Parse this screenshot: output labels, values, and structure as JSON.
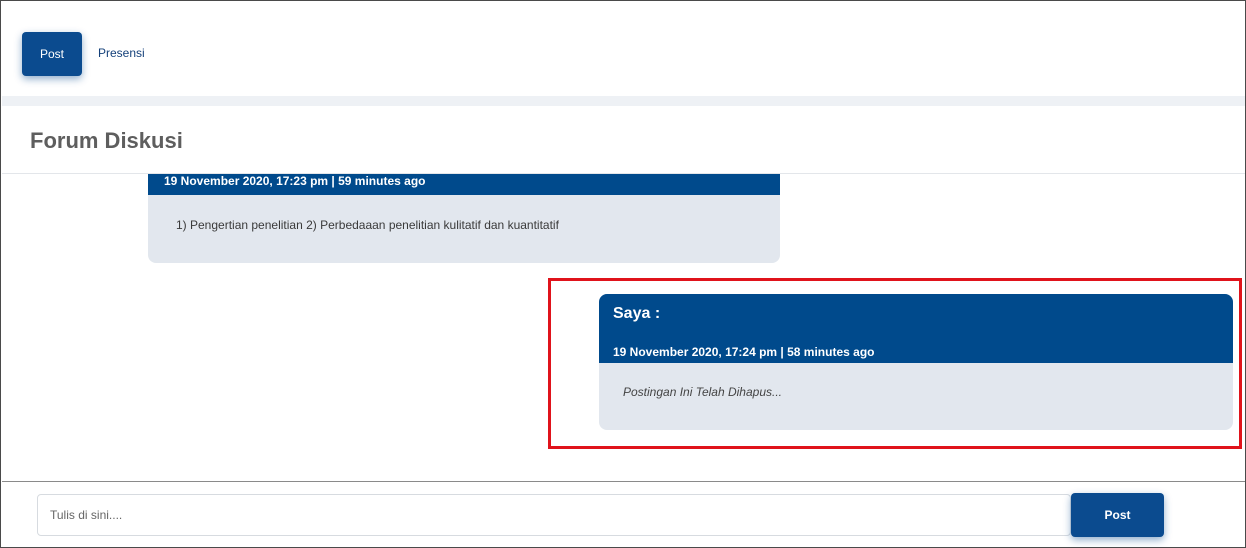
{
  "tabs": {
    "post_label": "Post",
    "presensi_label": "Presensi"
  },
  "forum": {
    "title": "Forum Diskusi"
  },
  "messages": [
    {
      "meta": "19 November 2020, 17:23 pm | 59 minutes ago",
      "body": "1) Pengertian penelitian 2) Perbedaaan penelitian kulitatif dan kuantitatif"
    },
    {
      "author": "Saya :",
      "meta": "19 November 2020, 17:24 pm | 58 minutes ago",
      "body": "Postingan Ini Telah Dihapus..."
    }
  ],
  "composer": {
    "placeholder": "Tulis di sini....",
    "post_label": "Post"
  },
  "colors": {
    "primary": "#0b4b8f",
    "message_header": "#004a8c",
    "message_body": "#e2e7ee",
    "highlight": "#e0131b"
  }
}
